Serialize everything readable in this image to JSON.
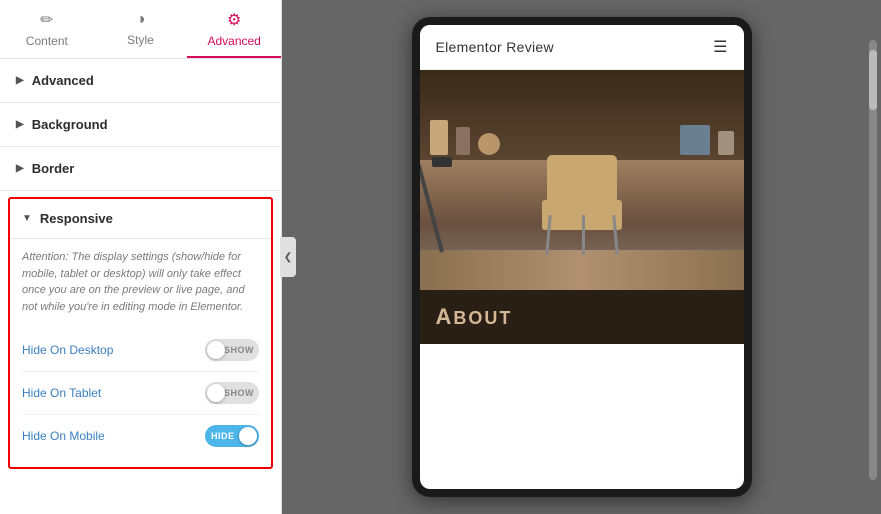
{
  "tabs": [
    {
      "id": "content",
      "label": "Content",
      "icon": "✏",
      "active": false
    },
    {
      "id": "style",
      "label": "Style",
      "icon": "◑",
      "active": false
    },
    {
      "id": "advanced",
      "label": "Advanced",
      "icon": "⚙",
      "active": true
    }
  ],
  "sections": [
    {
      "id": "advanced",
      "label": "Advanced",
      "expanded": false
    },
    {
      "id": "background",
      "label": "Background",
      "expanded": false
    },
    {
      "id": "border",
      "label": "Border",
      "expanded": false
    }
  ],
  "responsive": {
    "header": "Responsive",
    "note": "Attention: The display settings (show/hide for mobile, tablet or desktop) will only take effect once you are on the preview or live page, and not while you're in editing mode in Elementor.",
    "items": [
      {
        "id": "hide-desktop",
        "label": "Hide On Desktop",
        "state": "off",
        "toggleText": "SHOW"
      },
      {
        "id": "hide-tablet",
        "label": "Hide On Tablet",
        "state": "off",
        "toggleText": "SHOW"
      },
      {
        "id": "hide-mobile",
        "label": "Hide On Mobile",
        "state": "on",
        "toggleText": "HIDE"
      }
    ]
  },
  "preview": {
    "site_title": "Elementor Review",
    "about_label": "About"
  }
}
